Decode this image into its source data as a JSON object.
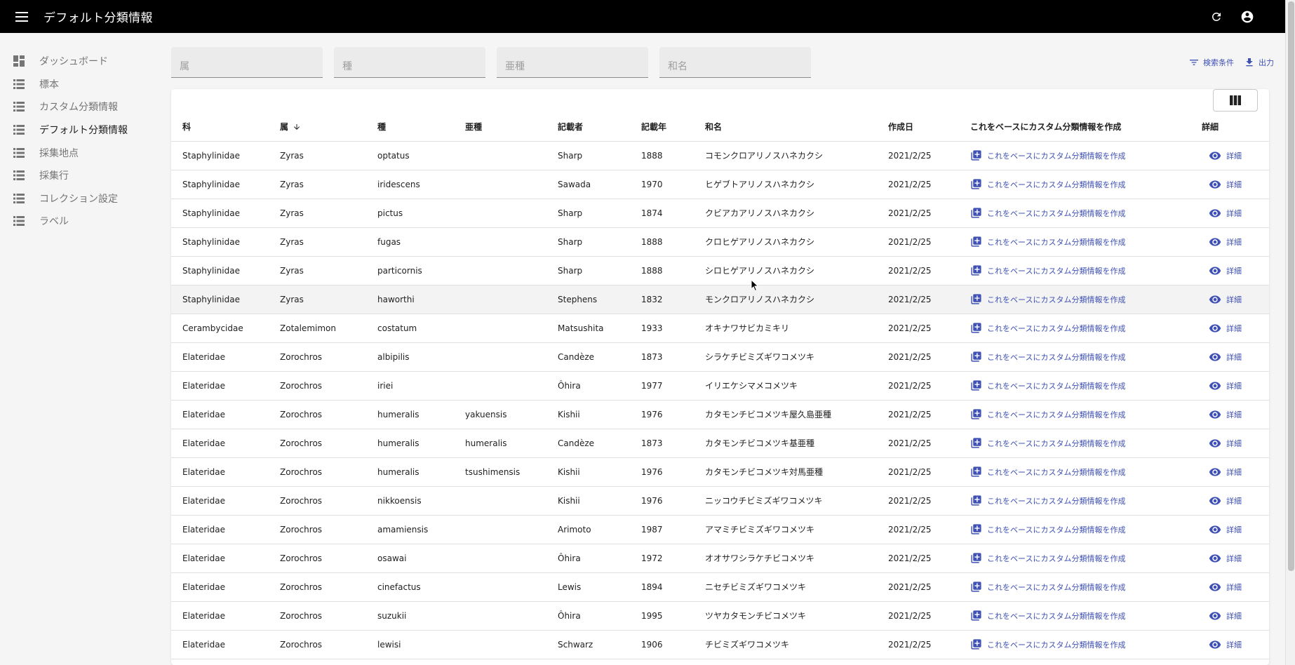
{
  "app": {
    "title": "デフォルト分類情報"
  },
  "appbar_icons": [
    "menu-icon",
    "refresh-icon",
    "account-circle-icon"
  ],
  "sidebar": {
    "items": [
      {
        "label": "ダッシュボード",
        "icon": "dashboard-icon",
        "active": false
      },
      {
        "label": "標本",
        "icon": "list-icon",
        "active": false
      },
      {
        "label": "カスタム分類情報",
        "icon": "list-icon",
        "active": false
      },
      {
        "label": "デフォルト分類情報",
        "icon": "list-icon",
        "active": true
      },
      {
        "label": "採集地点",
        "icon": "list-icon",
        "active": false
      },
      {
        "label": "採集行",
        "icon": "list-icon",
        "active": false
      },
      {
        "label": "コレクション設定",
        "icon": "list-icon",
        "active": false
      },
      {
        "label": "ラベル",
        "icon": "list-icon",
        "active": false
      }
    ]
  },
  "filters": {
    "genus_placeholder": "属",
    "species_placeholder": "種",
    "subspecies_placeholder": "亜種",
    "japanese_name_placeholder": "和名"
  },
  "toolbar": {
    "filter_label": "検索条件",
    "export_label": "出力"
  },
  "table": {
    "headers": [
      "科",
      "属",
      "種",
      "亜種",
      "記載者",
      "記載年",
      "和名",
      "作成日",
      "これをベースにカスタム分類情報を作成",
      "詳細"
    ],
    "sorted_column": "属",
    "sort_direction": "ascending",
    "create_label": "これをベースにカスタム分類情報を作成",
    "detail_label": "詳細",
    "hover_row": 5,
    "rows": [
      [
        "Staphylinidae",
        "Zyras",
        "optatus",
        "",
        "Sharp",
        "1888",
        "コモンクロアリノスハネカクシ",
        "2021/2/25"
      ],
      [
        "Staphylinidae",
        "Zyras",
        "iridescens",
        "",
        "Sawada",
        "1970",
        "ヒゲブトアリノスハネカクシ",
        "2021/2/25"
      ],
      [
        "Staphylinidae",
        "Zyras",
        "pictus",
        "",
        "Sharp",
        "1874",
        "クビアカアリノスハネカクシ",
        "2021/2/25"
      ],
      [
        "Staphylinidae",
        "Zyras",
        "fugas",
        "",
        "Sharp",
        "1888",
        "クロヒゲアリノスハネカクシ",
        "2021/2/25"
      ],
      [
        "Staphylinidae",
        "Zyras",
        "particornis",
        "",
        "Sharp",
        "1888",
        "シロヒゲアリノスハネカクシ",
        "2021/2/25"
      ],
      [
        "Staphylinidae",
        "Zyras",
        "haworthi",
        "",
        "Stephens",
        "1832",
        "モンクロアリノスハネカクシ",
        "2021/2/25"
      ],
      [
        "Cerambycidae",
        "Zotalemimon",
        "costatum",
        "",
        "Matsushita",
        "1933",
        "オキナワサビカミキリ",
        "2021/2/25"
      ],
      [
        "Elateridae",
        "Zorochros",
        "albipilis",
        "",
        "Candèze",
        "1873",
        "シラケチビミズギワコメツキ",
        "2021/2/25"
      ],
      [
        "Elateridae",
        "Zorochros",
        "iriei",
        "",
        "Ôhira",
        "1977",
        "イリエケシマメコメツキ",
        "2021/2/25"
      ],
      [
        "Elateridae",
        "Zorochros",
        "humeralis",
        "yakuensis",
        "Kishii",
        "1976",
        "カタモンチビコメツキ屋久島亜種",
        "2021/2/25"
      ],
      [
        "Elateridae",
        "Zorochros",
        "humeralis",
        "humeralis",
        "Candèze",
        "1873",
        "カタモンチビコメツキ基亜種",
        "2021/2/25"
      ],
      [
        "Elateridae",
        "Zorochros",
        "humeralis",
        "tsushimensis",
        "Kishii",
        "1976",
        "カタモンチビコメツキ対馬亜種",
        "2021/2/25"
      ],
      [
        "Elateridae",
        "Zorochros",
        "nikkoensis",
        "",
        "Kishii",
        "1976",
        "ニッコウチビミズギワコメツキ",
        "2021/2/25"
      ],
      [
        "Elateridae",
        "Zorochros",
        "amamiensis",
        "",
        "Arimoto",
        "1987",
        "アマミチビミズギワコメツキ",
        "2021/2/25"
      ],
      [
        "Elateridae",
        "Zorochros",
        "osawai",
        "",
        "Ôhira",
        "1972",
        "オオサワシラケチビコメツキ",
        "2021/2/25"
      ],
      [
        "Elateridae",
        "Zorochros",
        "cinefactus",
        "",
        "Lewis",
        "1894",
        "ニセチビミズギワコメツキ",
        "2021/2/25"
      ],
      [
        "Elateridae",
        "Zorochros",
        "suzukii",
        "",
        "Ôhira",
        "1995",
        "ツヤカタモンチビコメツキ",
        "2021/2/25"
      ],
      [
        "Elateridae",
        "Zorochros",
        "lewisi",
        "",
        "Schwarz",
        "1906",
        "チビミズギワコメツキ",
        "2021/2/25"
      ]
    ]
  }
}
